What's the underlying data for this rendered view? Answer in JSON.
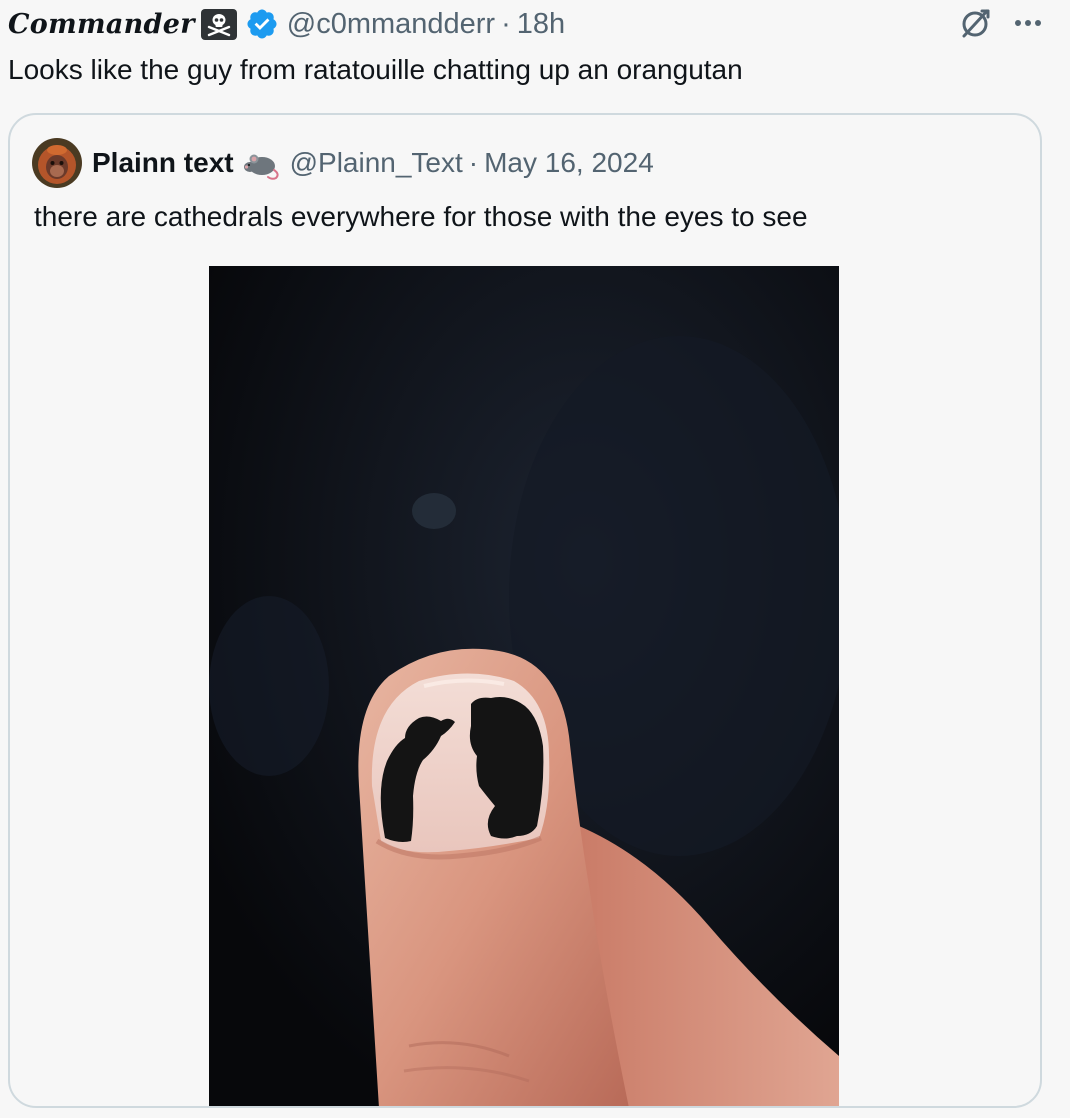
{
  "tweet": {
    "author_name": "Commander",
    "author_handle": "@c0mmandderr",
    "separator": "·",
    "time": "18h",
    "text": "Looks like the guy from ratatouille chatting up an orangutan",
    "icons": {
      "badge": "skull-crossbones-icon",
      "verified": "verified-checkmark-icon",
      "grok": "grok-icon",
      "more": "more-options-icon"
    }
  },
  "quote": {
    "author_name": "Plainn text",
    "author_handle": "@Plainn_Text",
    "separator": "·",
    "date": "May 16, 2024",
    "text": "there are cathedrals everywhere for those with the eyes to see",
    "icons": {
      "name_emoji": "rat-emoji-icon",
      "avatar": "orangutan-avatar"
    },
    "photo": "thumbnail-nail-polish-photo"
  },
  "colors": {
    "background": "#f7f7f7",
    "text_primary": "#0f1419",
    "text_secondary": "#536471",
    "border": "#cfd9de",
    "verified_blue": "#1d9bf0"
  }
}
